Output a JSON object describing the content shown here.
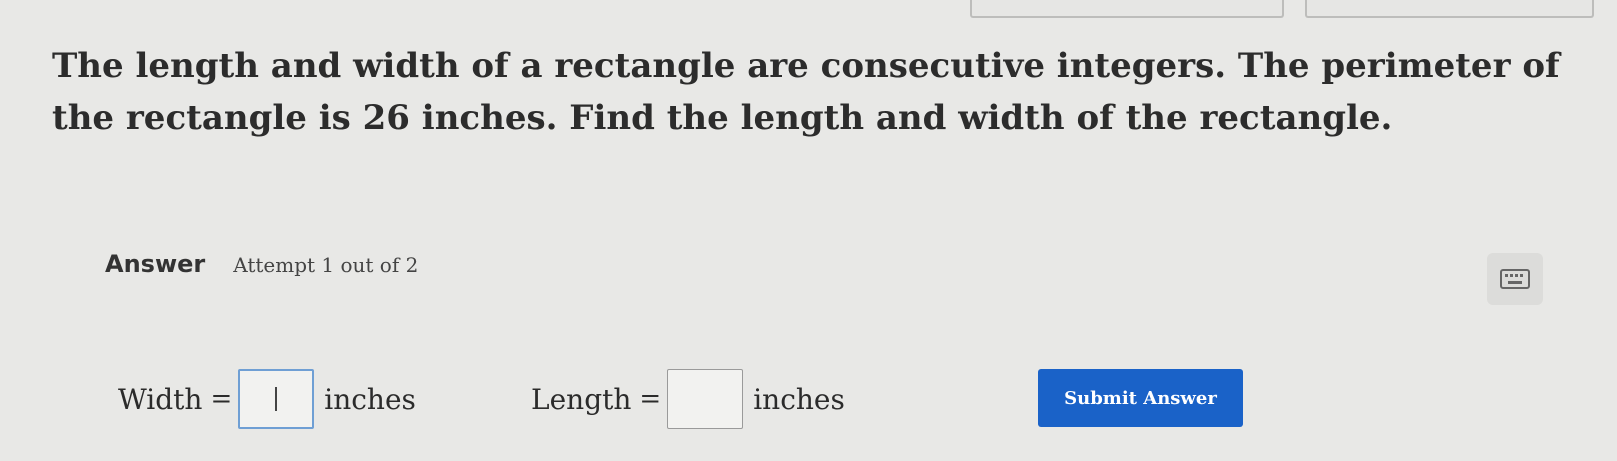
{
  "question": {
    "text": "The length and width of a rectangle are consecutive integers. The perimeter of the rectangle is 26 inches. Find the length and width of the rectangle."
  },
  "answer": {
    "label": "Answer",
    "attempt": "Attempt 1 out of 2",
    "keyboard_icon": "keyboard-icon"
  },
  "fields": {
    "width": {
      "label": "Width",
      "equals": "=",
      "value": "",
      "unit": "inches"
    },
    "length": {
      "label": "Length",
      "equals": "=",
      "value": "",
      "unit": "inches"
    }
  },
  "submit": {
    "label": "Submit Answer"
  },
  "colors": {
    "background": "#e8e8e6",
    "submit_button": "#1a62c8",
    "focused_input_border": "#6f9fd4"
  }
}
